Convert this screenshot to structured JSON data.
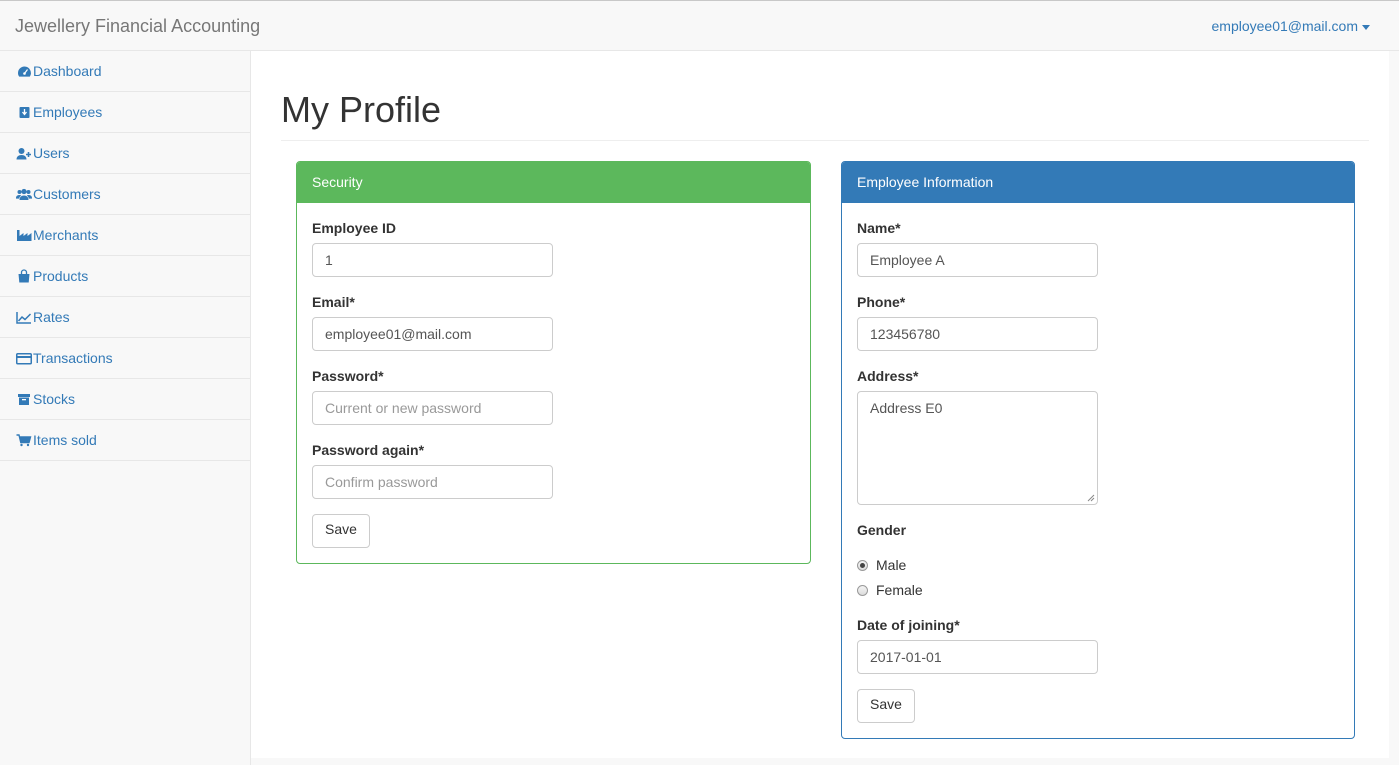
{
  "navbar": {
    "brand": "Jewellery Financial Accounting",
    "user_email": "employee01@mail.com"
  },
  "sidebar": {
    "items": [
      {
        "label": "Dashboard",
        "icon": "dashboard-icon"
      },
      {
        "label": "Employees",
        "icon": "badge-icon"
      },
      {
        "label": "Users",
        "icon": "add-user-icon"
      },
      {
        "label": "Customers",
        "icon": "users-icon"
      },
      {
        "label": "Merchants",
        "icon": "industry-icon"
      },
      {
        "label": "Products",
        "icon": "shopping-bag-icon"
      },
      {
        "label": "Rates",
        "icon": "line-chart-icon"
      },
      {
        "label": "Transactions",
        "icon": "credit-card-icon"
      },
      {
        "label": "Stocks",
        "icon": "archive-icon"
      },
      {
        "label": "Items sold",
        "icon": "shopping-cart-icon"
      }
    ]
  },
  "page": {
    "title": "My Profile"
  },
  "security": {
    "heading": "Security",
    "employee_id_label": "Employee ID",
    "employee_id_value": "1",
    "email_label": "Email",
    "email_value": "employee01@mail.com",
    "password_label": "Password",
    "password_placeholder": "Current or new password",
    "password_again_label": "Password again",
    "password_again_placeholder": "Confirm password",
    "save_label": "Save",
    "required_mark": "*"
  },
  "employee_info": {
    "heading": "Employee Information",
    "name_label": "Name",
    "name_value": "Employee A",
    "phone_label": "Phone",
    "phone_value": "123456780",
    "address_label": "Address",
    "address_value": "Address E0",
    "gender_label": "Gender",
    "gender_options": [
      "Male",
      "Female"
    ],
    "gender_selected": "Male",
    "date_label": "Date of joining",
    "date_value": "2017-01-01",
    "save_label": "Save",
    "required_mark": "*"
  },
  "colors": {
    "link": "#337ab7",
    "success": "#5cb85c",
    "primary": "#337ab7"
  }
}
